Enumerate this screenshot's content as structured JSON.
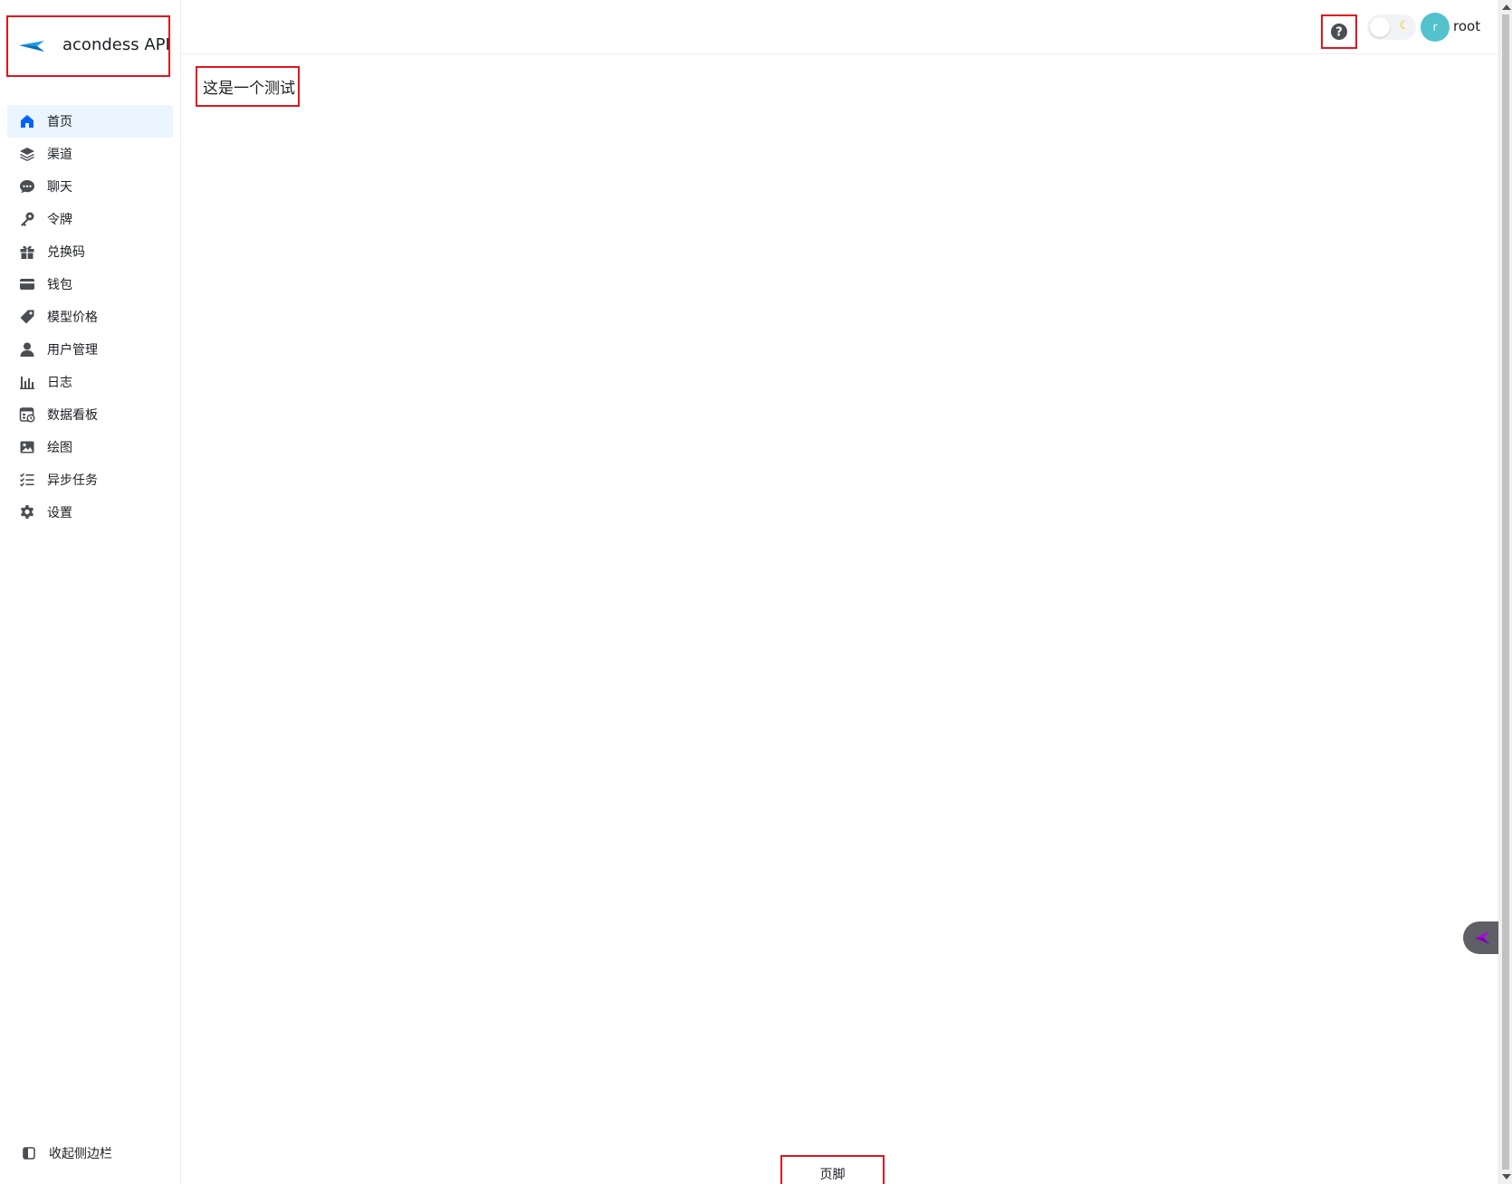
{
  "brand": {
    "name": "acondess API",
    "accent": "#1c9ce6"
  },
  "sidebar": {
    "items": [
      {
        "label": "首页",
        "icon": "home-icon",
        "active": true
      },
      {
        "label": "渠道",
        "icon": "layers-icon"
      },
      {
        "label": "聊天",
        "icon": "chat-icon"
      },
      {
        "label": "令牌",
        "icon": "key-icon"
      },
      {
        "label": "兑换码",
        "icon": "gift-icon"
      },
      {
        "label": "钱包",
        "icon": "card-icon"
      },
      {
        "label": "模型价格",
        "icon": "tag-icon"
      },
      {
        "label": "用户管理",
        "icon": "user-icon"
      },
      {
        "label": "日志",
        "icon": "bar-chart-icon"
      },
      {
        "label": "数据看板",
        "icon": "dashboard-icon"
      },
      {
        "label": "绘图",
        "icon": "image-icon"
      },
      {
        "label": "异步任务",
        "icon": "checklist-icon"
      },
      {
        "label": "设置",
        "icon": "gear-icon"
      }
    ],
    "collapse_label": "收起侧边栏"
  },
  "header": {
    "user": {
      "name": "root",
      "avatar_letter": "r",
      "avatar_color": "#53c2cc"
    }
  },
  "main": {
    "text": "这是一个测试"
  },
  "footer": {
    "text": "页脚"
  }
}
